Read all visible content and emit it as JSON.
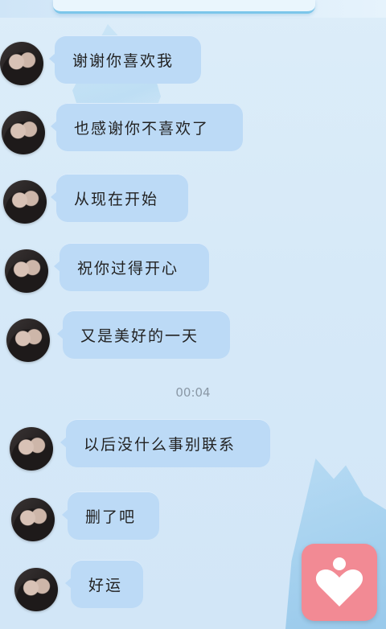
{
  "chat": {
    "messages": [
      {
        "text": "谢谢你喜欢我"
      },
      {
        "text": "也感谢你不喜欢了"
      },
      {
        "text": "从现在开始"
      },
      {
        "text": "祝你过得开心"
      },
      {
        "text": "又是美好的一天"
      },
      {
        "text": "以后没什么事别联系"
      },
      {
        "text": "删了吧"
      },
      {
        "text": "好运"
      }
    ],
    "timestamp": "00:04"
  },
  "ui": {
    "accent_color": "#7cc6ea",
    "bubble_color": "#bcdaf6",
    "floating_button_color": "#f28a94"
  },
  "icons": {
    "floating_button": "heart-person-icon"
  }
}
